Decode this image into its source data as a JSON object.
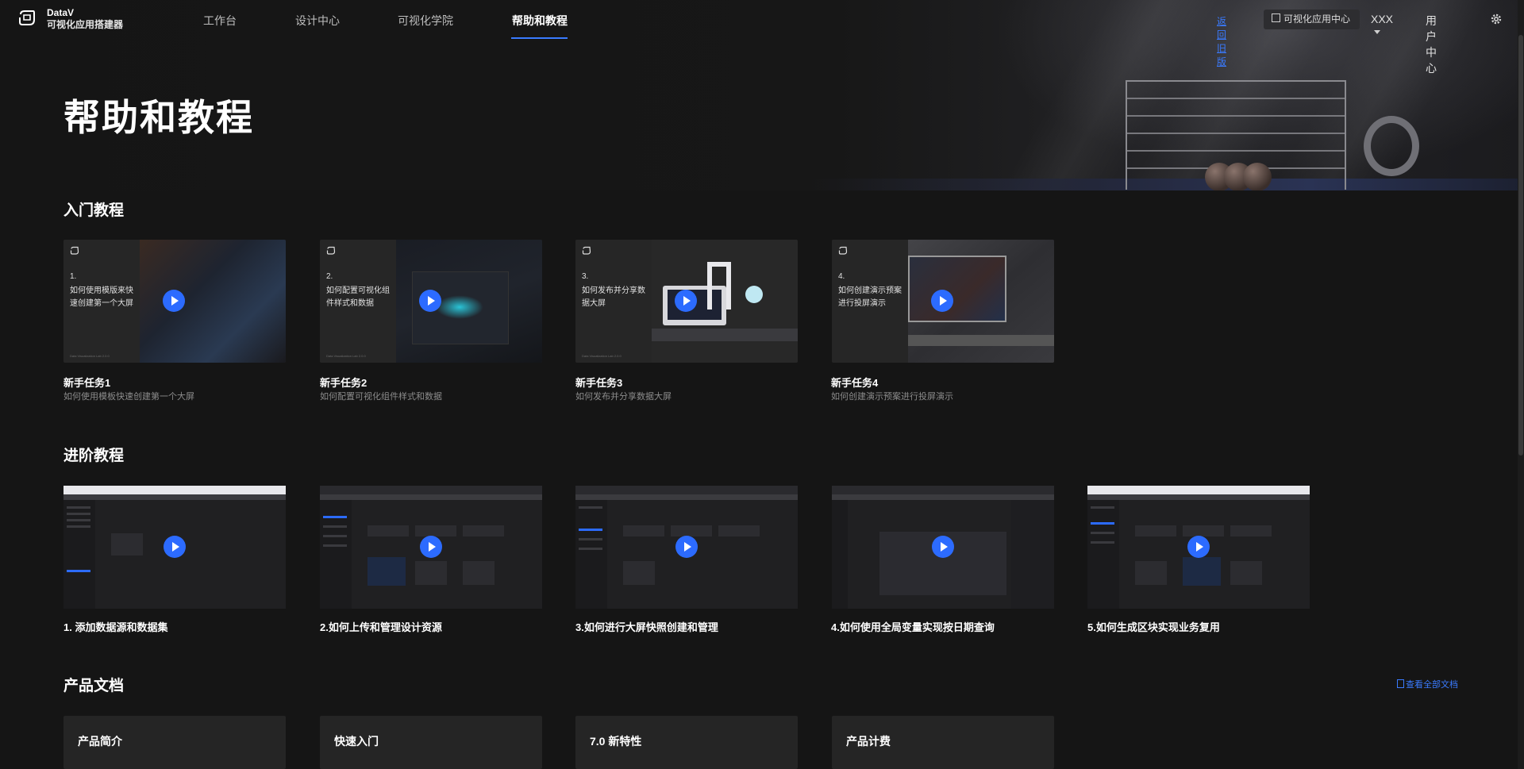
{
  "brand": {
    "name_line1": "DataV",
    "name_line2": "可视化应用搭建器"
  },
  "nav": {
    "items": [
      {
        "label": "工作台",
        "active": false
      },
      {
        "label": "设计中心",
        "active": false
      },
      {
        "label": "可视化学院",
        "active": false
      },
      {
        "label": "帮助和教程",
        "active": true
      }
    ]
  },
  "header_right": {
    "old_version_link": "返回旧版",
    "app_center": "可视化应用中心",
    "user": "XXX",
    "user_center": "用户中心"
  },
  "page_title": "帮助和教程",
  "intro": {
    "title": "入门教程",
    "cards": [
      {
        "num": "1.",
        "caption": "如何使用模版来快速创建第一个大屏",
        "title": "新手任务1",
        "desc": "如何使用模板快速创建第一个大屏",
        "footer": "Data Visualization Lab 2.0.0"
      },
      {
        "num": "2.",
        "caption": "如何配置可视化组件样式和数据",
        "title": "新手任务2",
        "desc": "如何配置可视化组件样式和数据",
        "footer": "Data Visualization Lab 2.0.0"
      },
      {
        "num": "3.",
        "caption": "如何发布并分享数据大屏",
        "title": "新手任务3",
        "desc": "如何发布并分享数据大屏",
        "footer": "Data Visualization Lab 2.0.0"
      },
      {
        "num": "4.",
        "caption": "如何创建演示预案进行投屏演示",
        "title": "新手任务4",
        "desc": "如何创建演示预案进行投屏演示",
        "footer": "Data Visualization Lab 2.0.0"
      }
    ]
  },
  "advanced": {
    "title": "进阶教程",
    "videos": [
      {
        "title": "1. 添加数据源和数据集"
      },
      {
        "title": "2.如何上传和管理设计资源"
      },
      {
        "title": "3.如何进行大屏快照创建和管理"
      },
      {
        "title": "4.如何使用全局变量实现按日期查询"
      },
      {
        "title": "5.如何生成区块实现业务复用"
      }
    ]
  },
  "docs": {
    "title": "产品文档",
    "view_all": "查看全部文档",
    "cards": [
      {
        "label": "产品简介"
      },
      {
        "label": "快速入门"
      },
      {
        "label": "7.0 新特性"
      },
      {
        "label": "产品计费"
      }
    ]
  },
  "colors": {
    "accent": "#2c6bff",
    "background": "#151515",
    "card": "#252525"
  }
}
